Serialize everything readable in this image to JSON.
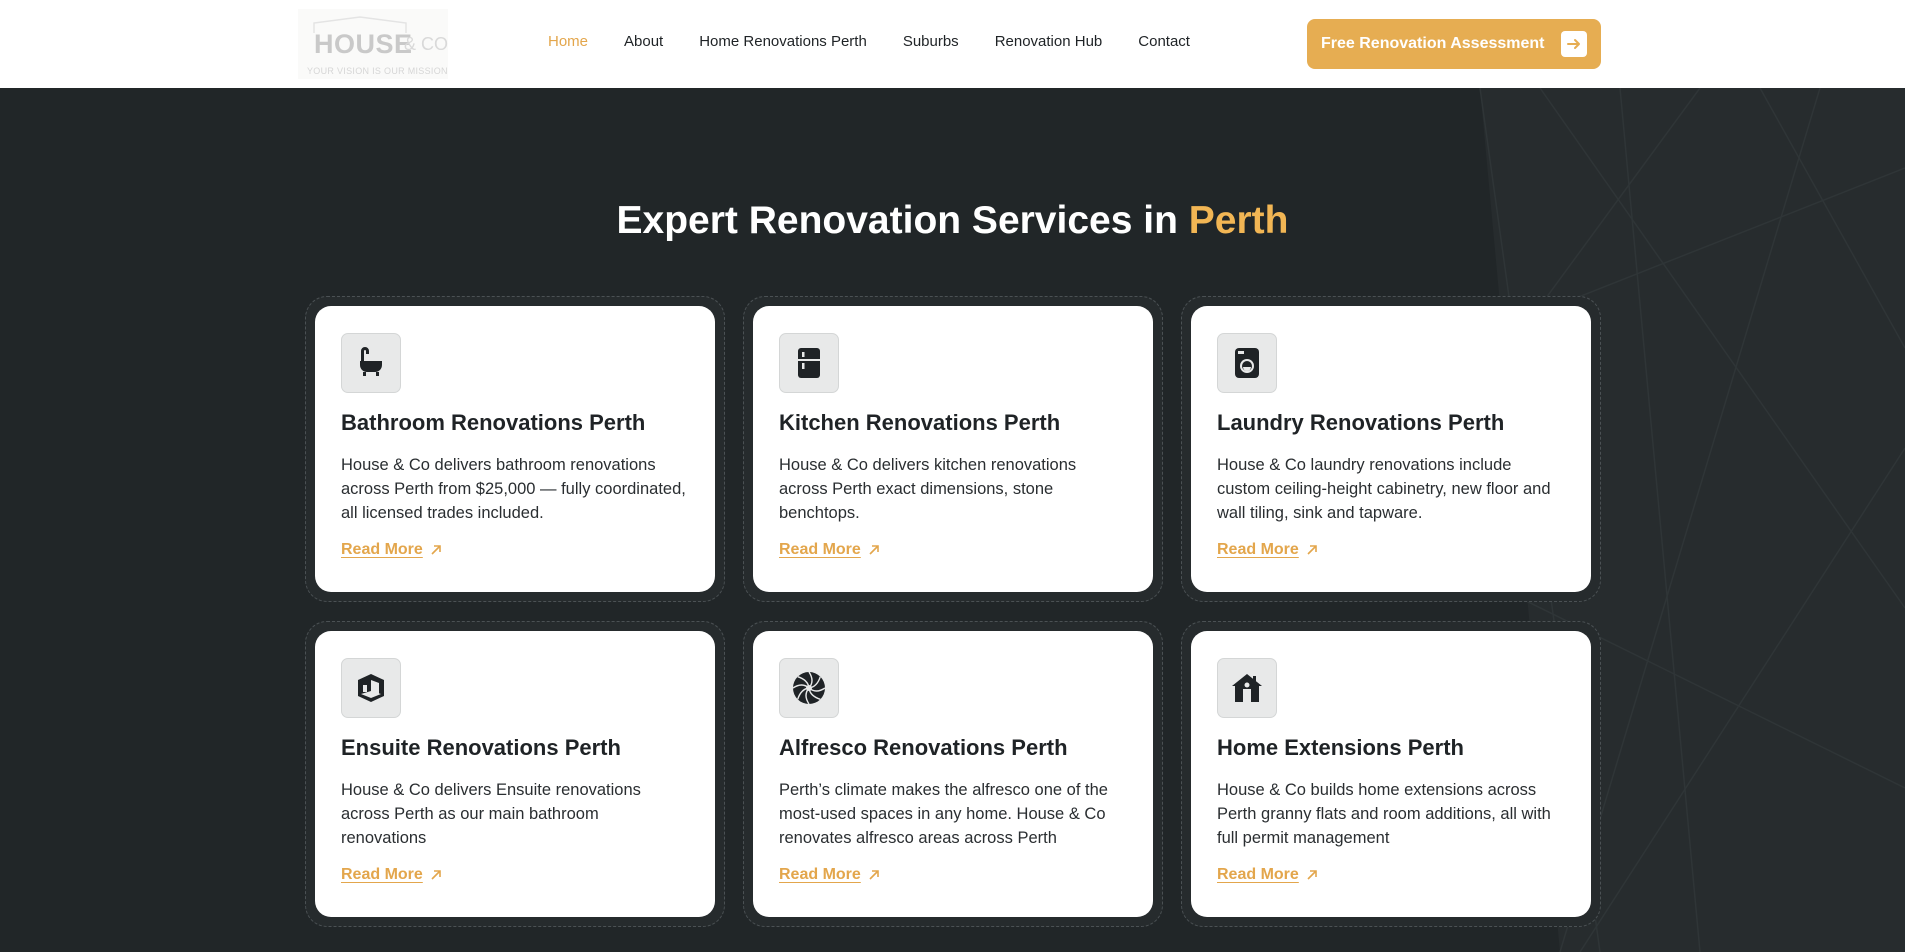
{
  "header": {
    "logo": {
      "main": "HOUSE",
      "co": "& CO",
      "tagline": "YOUR VISION IS OUR MISSION"
    },
    "nav": [
      {
        "label": "Home",
        "active": true
      },
      {
        "label": "About",
        "active": false
      },
      {
        "label": "Home Renovations Perth",
        "active": false
      },
      {
        "label": "Suburbs",
        "active": false
      },
      {
        "label": "Renovation Hub",
        "active": false
      },
      {
        "label": "Contact",
        "active": false
      }
    ],
    "cta_label": "Free Renovation Assessment"
  },
  "section": {
    "heading_main": "Expert Renovation Services in",
    "heading_accent": "Perth",
    "cards": [
      {
        "icon": "bathtub-icon",
        "title": "Bathroom Renovations Perth",
        "description": "House & Co delivers bathroom renovations across Perth from $25,000 — fully coordinated, all licensed trades included.",
        "link": "Read More"
      },
      {
        "icon": "fridge-icon",
        "title": "Kitchen Renovations Perth",
        "description": "House & Co delivers kitchen renovations across Perth exact dimensions, stone benchtops.",
        "link": "Read More"
      },
      {
        "icon": "washing-machine-icon",
        "title": "Laundry Renovations Perth",
        "description": "House & Co laundry renovations include custom ceiling-height cabinetry, new floor and wall tiling, sink and tapware.",
        "link": "Read More"
      },
      {
        "icon": "room-icon",
        "title": "Ensuite Renovations Perth",
        "description": "House & Co delivers Ensuite renovations across Perth as our main bathroom renovations",
        "link": "Read More"
      },
      {
        "icon": "aperture-icon",
        "title": "Alfresco Renovations Perth",
        "description": "Perth’s climate makes the alfresco one of the most-used spaces in any home. House & Co renovates alfresco areas across Perth",
        "link": "Read More"
      },
      {
        "icon": "house-icon",
        "title": "Home Extensions Perth",
        "description": "House & Co builds home extensions across Perth granny flats and room additions, all with full permit management",
        "link": "Read More"
      }
    ]
  },
  "colors": {
    "accent": "#e6ad52",
    "background": "#212628",
    "card": "#ffffff",
    "text": "#1f2326"
  }
}
